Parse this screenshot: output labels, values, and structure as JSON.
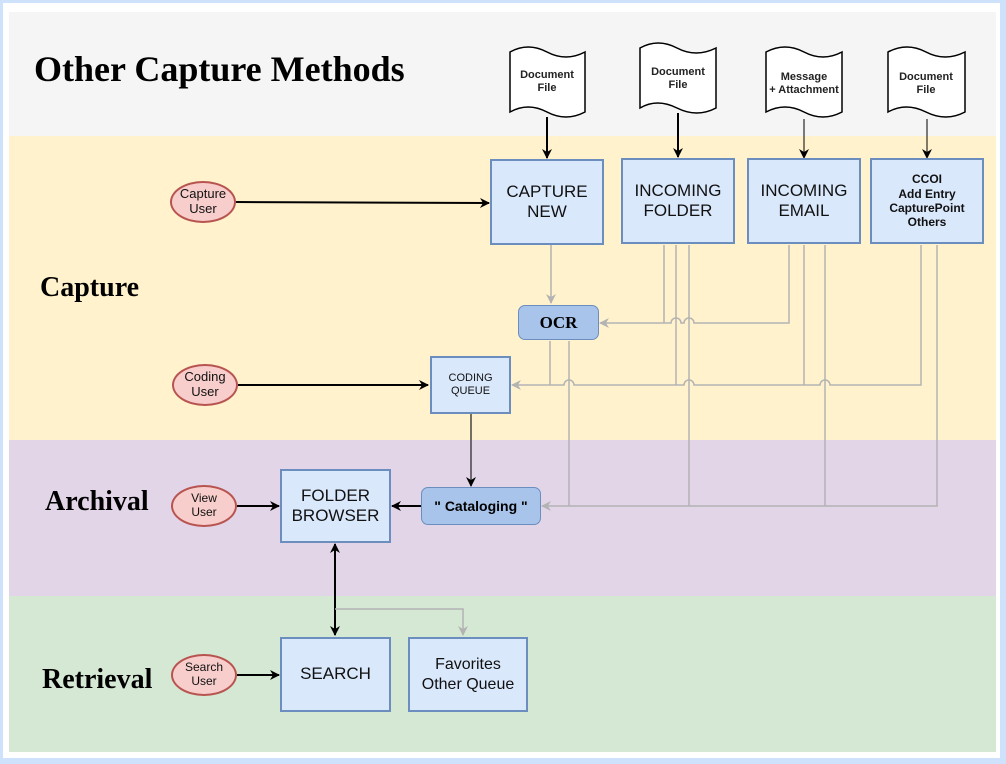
{
  "page_title": "Other Capture Methods",
  "lanes": {
    "capture": "Capture",
    "archival": "Archival",
    "retrieval": "Retrieval"
  },
  "documents": [
    {
      "label": "Document\nFile"
    },
    {
      "label": "Document\nFile"
    },
    {
      "label": "Message\n+ Attachment"
    },
    {
      "label": "Document\nFile"
    }
  ],
  "capture_sources": [
    {
      "label": "CAPTURE\nNEW"
    },
    {
      "label": "INCOMING\nFOLDER"
    },
    {
      "label": "INCOMING\nEMAIL"
    },
    {
      "label": "CCOI\nAdd Entry\nCapturePoint\nOthers"
    }
  ],
  "actors": {
    "capture_user": "Capture\nUser",
    "coding_user": "Coding\nUser",
    "view_user": "View\nUser",
    "search_user": "Search\nUser"
  },
  "processes": {
    "ocr": "OCR",
    "coding_queue": "CODING\nQUEUE",
    "cataloging": "\" Cataloging \"",
    "folder_browser": "FOLDER\nBROWSER",
    "search": "SEARCH",
    "favorites": "Favorites\nOther Queue"
  },
  "colors": {
    "header_lane": "#f5f5f5",
    "capture_lane": "#fff2cc",
    "archival_lane": "#e1d5e7",
    "retrieval_lane": "#d5e8d4",
    "box_fill": "#dae8fc",
    "box_stroke": "#6c8ebf",
    "process_fill": "#a9c4eb",
    "actor_fill": "#f8cecc",
    "actor_stroke": "#b85450",
    "flow_line": "#b3b3b3"
  }
}
